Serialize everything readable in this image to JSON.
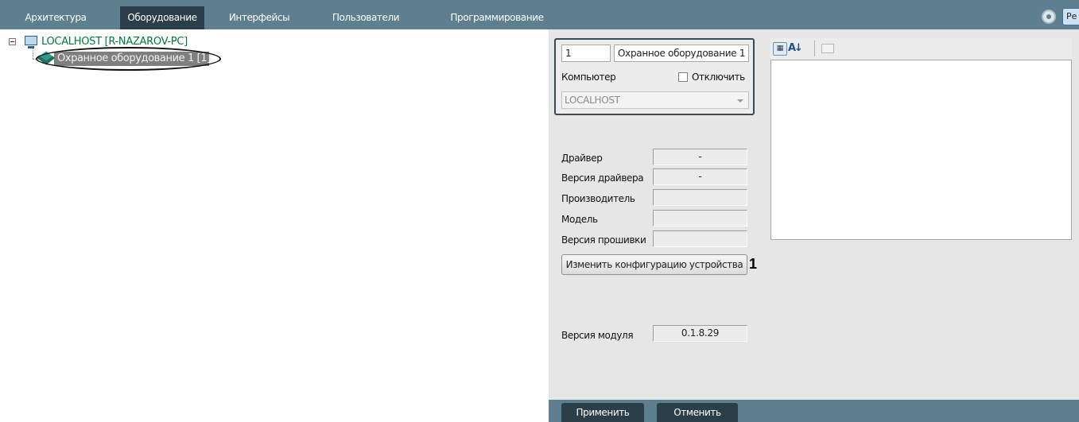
{
  "nav": {
    "tabs": [
      {
        "label": "Архитектура",
        "active": false
      },
      {
        "label": "Оборудование",
        "active": true
      },
      {
        "label": "Интерфейсы",
        "active": false
      },
      {
        "label": "Пользователи",
        "active": false
      },
      {
        "label": "Программирование",
        "active": false
      }
    ],
    "corner_button_label": "Ре"
  },
  "tree": {
    "root_label": "LOCALHOST [R-NAZAROV-PC]",
    "child_label": "Охранное оборудование 1 [1]"
  },
  "object": {
    "id": "1",
    "name": "Охранное оборудование 1",
    "computer_label": "Компьютер",
    "disable_label": "Отключить",
    "disable_checked": false,
    "computer_value": "LOCALHOST"
  },
  "info": {
    "driver_label": "Драйвер",
    "driver_value": "-",
    "driver_version_label": "Версия драйвера",
    "driver_version_value": "-",
    "manufacturer_label": "Производитель",
    "manufacturer_value": "",
    "model_label": "Модель",
    "model_value": "",
    "firmware_label": "Версия прошивки",
    "firmware_value": "",
    "change_config_button": "Изменить конфигурацию устройства",
    "callout_marker": "1",
    "module_version_label": "Версия модуля",
    "module_version_value": "0.1.8.29"
  },
  "property_grid": {
    "categorized_icon": "categorized-icon",
    "sort_az_icon": "sort-az-icon",
    "property_pages_icon": "property-pages-icon"
  },
  "footer": {
    "apply_label": "Применить",
    "cancel_label": "Отменить"
  },
  "colors": {
    "nav_bar": "#5e7f8f",
    "nav_active": "#2a3f49",
    "tree_root_text": "#007a3d",
    "selection": "#7f7f7f"
  }
}
